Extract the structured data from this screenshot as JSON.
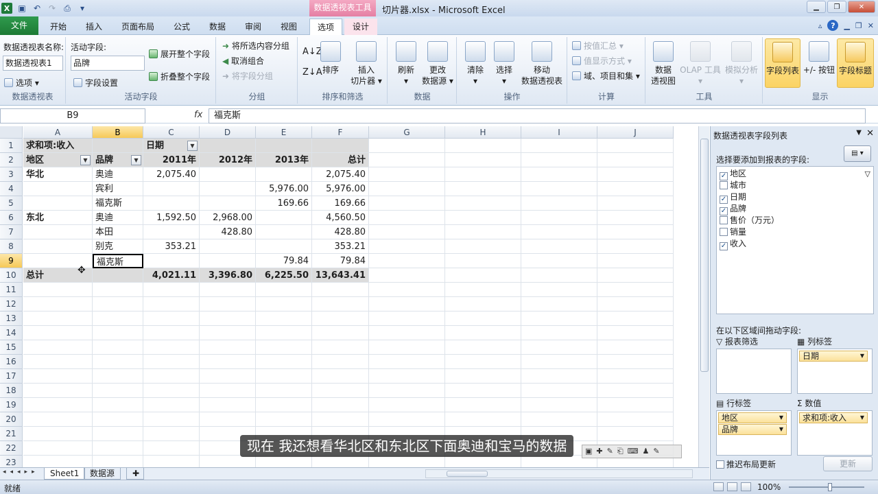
{
  "title": {
    "context_tab": "数据透视表工具",
    "window_title": "切片器.xlsx - Microsoft Excel"
  },
  "tabs": {
    "file": "文件",
    "home": "开始",
    "insert": "插入",
    "page_layout": "页面布局",
    "formulas": "公式",
    "data": "数据",
    "review": "审阅",
    "view": "视图",
    "options": "选项",
    "design": "设计"
  },
  "ribbon": {
    "pivot_name_label": "数据透视表名称:",
    "pivot_name_value": "数据透视表1",
    "options_btn": "选项",
    "group_pivot": "数据透视表",
    "active_field_label": "活动字段:",
    "active_field_value": "品牌",
    "field_settings": "字段设置",
    "expand_all": "展开整个字段",
    "collapse_all": "折叠整个字段",
    "group_active": "活动字段",
    "group_selection": "将所选内容分组",
    "ungroup": "取消组合",
    "group_field": "将字段分组",
    "group_group": "分组",
    "sort": "排序",
    "insert_slicer_1": "插入",
    "insert_slicer_2": "切片器",
    "group_sort": "排序和筛选",
    "refresh": "刷新",
    "change_source_1": "更改",
    "change_source_2": "数据源",
    "group_data": "数据",
    "clear": "清除",
    "select": "选择",
    "move_1": "移动",
    "move_2": "数据透视表",
    "group_actions": "操作",
    "summarize_by": "按值汇总",
    "show_values_as": "值显示方式",
    "fields_items_sets": "域、项目和集",
    "group_calc": "计算",
    "pivotchart_1": "数据",
    "pivotchart_2": "透视图",
    "olap": "OLAP 工具",
    "whatif": "模拟分析",
    "group_tools": "工具",
    "field_list": "字段列表",
    "buttons": "+/- 按钮",
    "field_headers": "字段标题",
    "group_show": "显示"
  },
  "formula_bar": {
    "name_box": "B9",
    "fx": "fx",
    "value": "福克斯"
  },
  "sheet": {
    "columns": [
      "A",
      "B",
      "C",
      "D",
      "E",
      "F",
      "G",
      "H",
      "I",
      "J"
    ],
    "rows": [
      "1",
      "2",
      "3",
      "4",
      "5",
      "6",
      "7",
      "8",
      "9",
      "10",
      "11",
      "12",
      "13",
      "14",
      "15",
      "16",
      "17",
      "18",
      "19",
      "20",
      "21",
      "22",
      "23"
    ],
    "cells": {
      "r1": [
        "求和项:收入",
        "",
        "日期",
        "",
        "",
        ""
      ],
      "r2": [
        "地区",
        "品牌",
        "2011年",
        "2012年",
        "2013年",
        "总计"
      ],
      "r3": [
        "华北",
        "奥迪",
        "2,075.40",
        "",
        "",
        "2,075.40"
      ],
      "r4": [
        "",
        "宾利",
        "",
        "",
        "5,976.00",
        "5,976.00"
      ],
      "r5": [
        "",
        "福克斯",
        "",
        "",
        "169.66",
        "169.66"
      ],
      "r6": [
        "东北",
        "奥迪",
        "1,592.50",
        "2,968.00",
        "",
        "4,560.50"
      ],
      "r7": [
        "",
        "本田",
        "",
        "428.80",
        "",
        "428.80"
      ],
      "r8": [
        "",
        "别克",
        "353.21",
        "",
        "",
        "353.21"
      ],
      "r9": [
        "",
        "福克斯",
        "",
        "",
        "79.84",
        "79.84"
      ],
      "r10": [
        "总计",
        "",
        "4,021.11",
        "3,396.80",
        "6,225.50",
        "13,643.41"
      ]
    },
    "tab_active": "Sheet1",
    "tab_2": "数据源"
  },
  "status": {
    "ready": "就绪",
    "zoom": "100%"
  },
  "pane": {
    "title": "数据透视表字段列表",
    "choose_label": "选择要添加到报表的字段:",
    "fields": [
      {
        "name": "地区",
        "checked": true
      },
      {
        "name": "城市",
        "checked": false
      },
      {
        "name": "日期",
        "checked": true
      },
      {
        "name": "品牌",
        "checked": true
      },
      {
        "name": "售价（万元）",
        "checked": false
      },
      {
        "name": "销量",
        "checked": false
      },
      {
        "name": "收入",
        "checked": true
      }
    ],
    "drag_label": "在以下区域间拖动字段:",
    "report_filter": "报表筛选",
    "column_labels": "列标签",
    "row_labels": "行标签",
    "values": "数值",
    "col_chip": "日期",
    "row_chip_1": "地区",
    "row_chip_2": "品牌",
    "val_chip": "求和项:收入",
    "defer": "推迟布局更新",
    "update": "更新"
  },
  "subtitle": "现在  我还想看华北区和东北区下面奥迪和宝马的数据"
}
